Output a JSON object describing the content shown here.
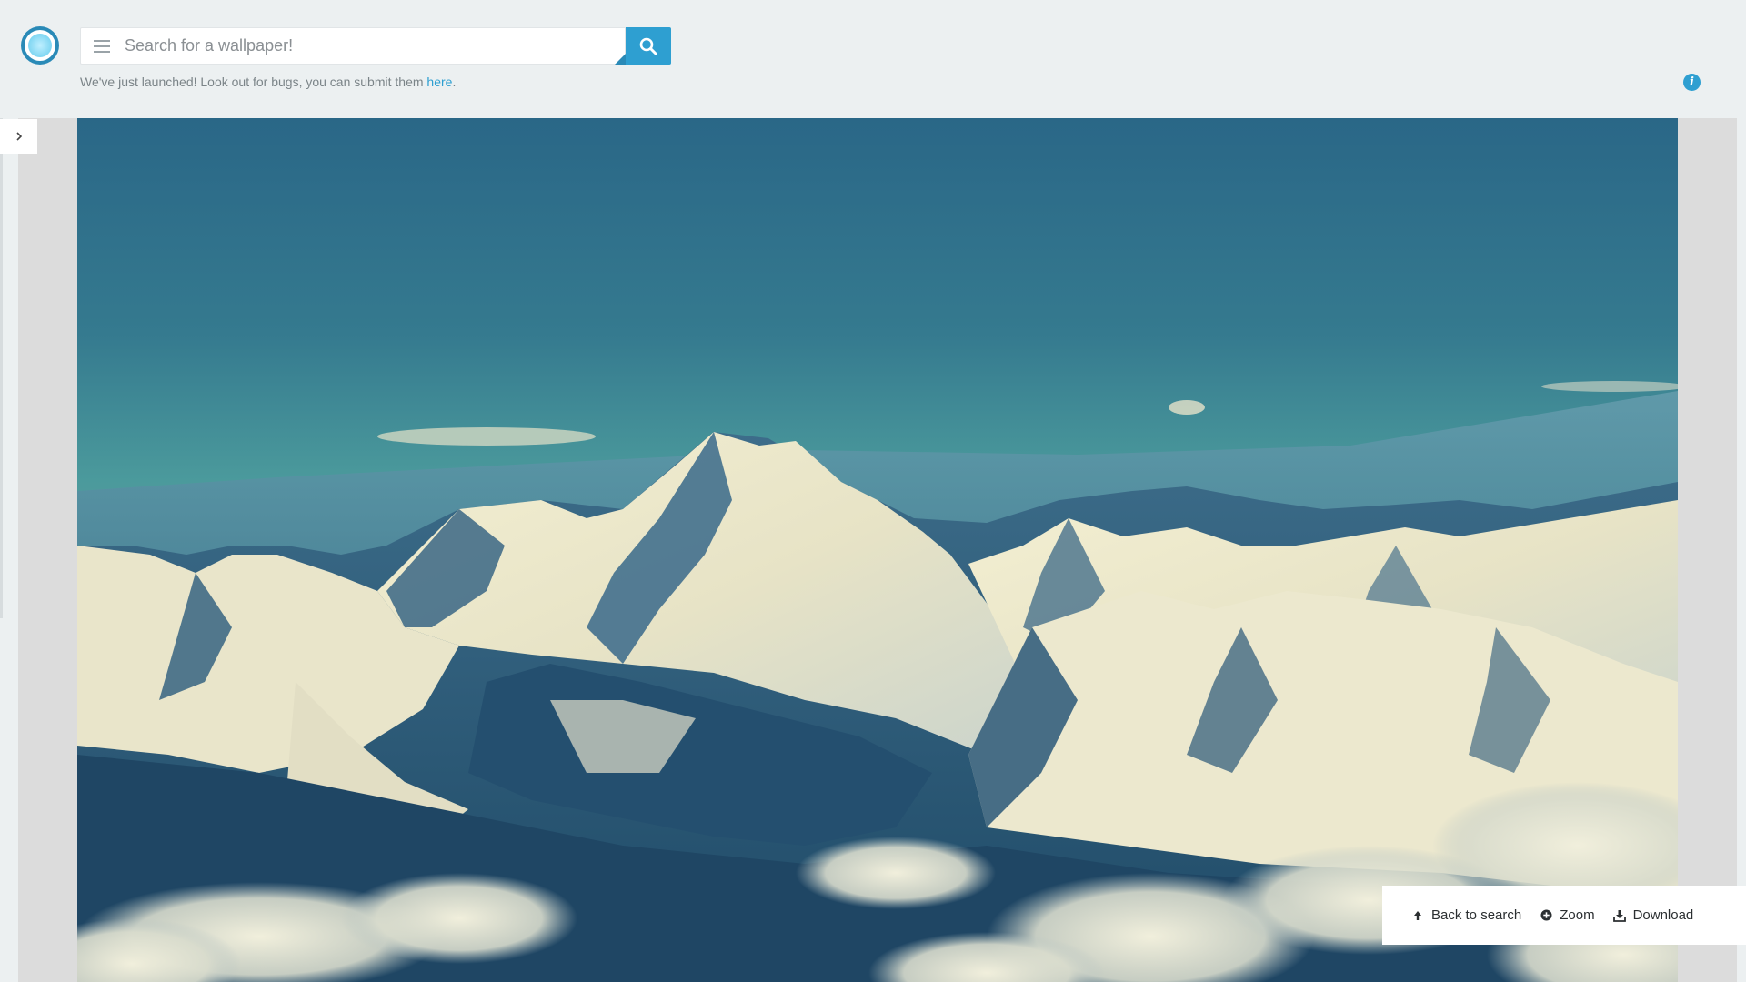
{
  "search": {
    "placeholder": "Search for a wallpaper!"
  },
  "notice": {
    "text": "We've just launched! Look out for bugs, you can submit them ",
    "link_label": "here",
    "suffix": "."
  },
  "info": {
    "glyph": "i"
  },
  "actions": {
    "back_label": "Back to search",
    "zoom_label": "Zoom",
    "download_label": "Download"
  },
  "colors": {
    "accent": "#2e9fd1",
    "background": "#ecf0f1"
  },
  "icons": {
    "logo": "logo-icon",
    "menu": "menu-icon",
    "search": "search-icon",
    "info": "info-icon",
    "toggle": "chevron-right-icon",
    "back": "arrow-up-icon",
    "zoom": "zoom-plus-icon",
    "download": "download-icon"
  }
}
